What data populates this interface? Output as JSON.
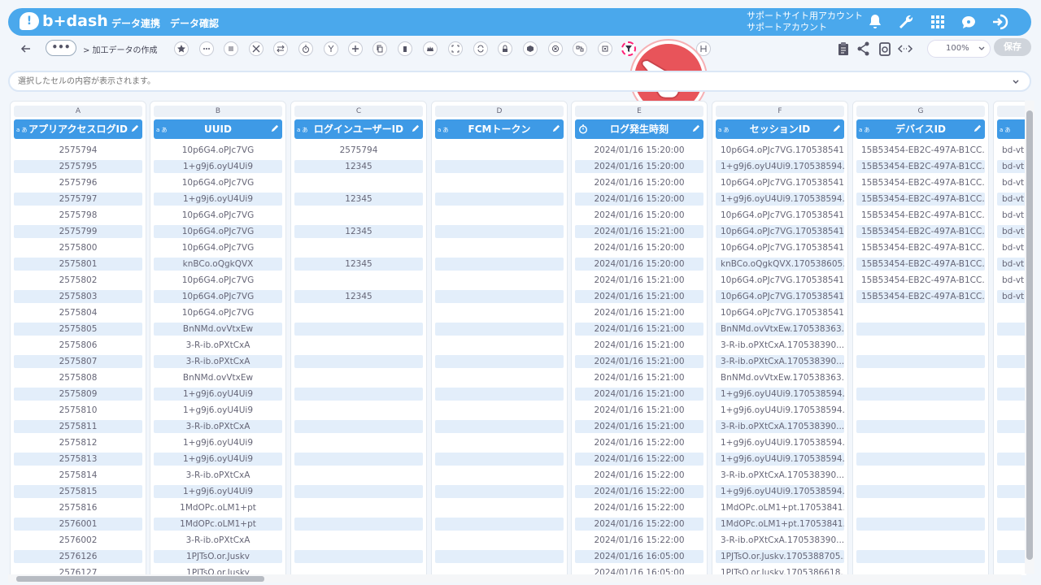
{
  "app": {
    "logo_text": "b+dash"
  },
  "nav": {
    "items": [
      "データ連携",
      "データ確認"
    ]
  },
  "account": {
    "line1": "サポートサイト用アカウント",
    "line2": "サポートアカウント"
  },
  "toolbar": {
    "more_label": "•••",
    "breadcrumb": "> 加工データの作成",
    "zoom": "100%",
    "save_label": "保存"
  },
  "cellbar": {
    "placeholder": "選択したセルの内容が表示されます。"
  },
  "columns": [
    {
      "letter": "A",
      "name": "アプリアクセスログID",
      "type": "a あ",
      "align": "center",
      "cells": [
        "2575794",
        "2575795",
        "2575796",
        "2575797",
        "2575798",
        "2575799",
        "2575800",
        "2575801",
        "2575802",
        "2575803",
        "2575804",
        "2575805",
        "2575806",
        "2575807",
        "2575808",
        "2575809",
        "2575810",
        "2575811",
        "2575812",
        "2575813",
        "2575814",
        "2575815",
        "2575816",
        "2576001",
        "2576002",
        "2576126",
        "2576127"
      ]
    },
    {
      "letter": "B",
      "name": "UUID",
      "type": "a あ",
      "align": "center",
      "cells": [
        "10p6G4.oPJc7VG",
        "1+g9j6.oyU4Ui9",
        "10p6G4.oPJc7VG",
        "1+g9j6.oyU4Ui9",
        "10p6G4.oPJc7VG",
        "10p6G4.oPJc7VG",
        "10p6G4.oPJc7VG",
        "knBCo.oQgkQVX",
        "10p6G4.oPJc7VG",
        "10p6G4.oPJc7VG",
        "10p6G4.oPJc7VG",
        "BnNMd.ovVtxEw",
        "3-R-ib.oPXtCxA",
        "3-R-ib.oPXtCxA",
        "BnNMd.ovVtxEw",
        "1+g9j6.oyU4Ui9",
        "1+g9j6.oyU4Ui9",
        "3-R-ib.oPXtCxA",
        "1+g9j6.oyU4Ui9",
        "1+g9j6.oyU4Ui9",
        "3-R-ib.oPXtCxA",
        "1+g9j6.oyU4Ui9",
        "1MdOPc.oLM1+pt",
        "1MdOPc.oLM1+pt",
        "3-R-ib.oPXtCxA",
        "1PJTsO.or.Juskv",
        "1PJTsO.or.Jusky"
      ]
    },
    {
      "letter": "C",
      "name": "ログインユーザーID",
      "type": "a あ",
      "align": "center",
      "cells": [
        "2575794",
        "12345",
        "",
        "12345",
        "",
        "12345",
        "",
        "12345",
        "",
        "12345",
        "",
        "",
        "",
        "",
        "",
        "",
        "",
        "",
        "",
        "",
        "",
        "",
        "",
        "",
        "",
        "",
        ""
      ]
    },
    {
      "letter": "D",
      "name": "FCMトークン",
      "type": "a あ",
      "align": "center",
      "cells": [
        "",
        "",
        "",
        "",
        "",
        "",
        "",
        "",
        "",
        "",
        "",
        "",
        "",
        "",
        "",
        "",
        "",
        "",
        "",
        "",
        "",
        "",
        "",
        "",
        "",
        "",
        ""
      ]
    },
    {
      "letter": "E",
      "name": "ログ発生時刻",
      "type": "clock",
      "align": "center",
      "cells": [
        "2024/01/16 15:20:00",
        "2024/01/16 15:20:00",
        "2024/01/16 15:20:00",
        "2024/01/16 15:20:00",
        "2024/01/16 15:20:00",
        "2024/01/16 15:21:00",
        "2024/01/16 15:20:00",
        "2024/01/16 15:20:00",
        "2024/01/16 15:21:00",
        "2024/01/16 15:21:00",
        "2024/01/16 15:21:00",
        "2024/01/16 15:21:00",
        "2024/01/16 15:21:00",
        "2024/01/16 15:21:00",
        "2024/01/16 15:21:00",
        "2024/01/16 15:21:00",
        "2024/01/16 15:21:00",
        "2024/01/16 15:21:00",
        "2024/01/16 15:22:00",
        "2024/01/16 15:22:00",
        "2024/01/16 15:22:00",
        "2024/01/16 15:22:00",
        "2024/01/16 15:22:00",
        "2024/01/16 15:22:00",
        "2024/01/16 15:22:00",
        "2024/01/16 16:05:00",
        "2024/01/16 16:05:00"
      ]
    },
    {
      "letter": "F",
      "name": "セッションID",
      "type": "a あ",
      "align": "left",
      "cells": [
        "10p6G4.oPJc7VG.170538541...",
        "1+g9j6.oyU4Ui9.170538594...",
        "10p6G4.oPJc7VG.170538541...",
        "1+g9j6.oyU4Ui9.170538594...",
        "10p6G4.oPJc7VG.170538541...",
        "10p6G4.oPJc7VG.170538541...",
        "10p6G4.oPJc7VG.170538541...",
        "knBCo.oQgkQVX.170538605...",
        "10p6G4.oPJc7VG.170538541...",
        "10p6G4.oPJc7VG.170538541...",
        "10p6G4.oPJc7VG.170538541...",
        "BnNMd.ovVtxEw.170538363...",
        "3-R-ib.oPXtCxA.170538390...",
        "3-R-ib.oPXtCxA.170538390...",
        "BnNMd.ovVtxEw.170538363...",
        "1+g9j6.oyU4Ui9.170538594...",
        "1+g9j6.oyU4Ui9.170538594...",
        "3-R-ib.oPXtCxA.170538390...",
        "1+g9j6.oyU4Ui9.170538594...",
        "1+g9j6.oyU4Ui9.170538594...",
        "3-R-ib.oPXtCxA.170538390...",
        "1+g9j6.oyU4Ui9.170538594...",
        "1MdOPc.oLM1+pt.17053841...",
        "1MdOPc.oLM1+pt.17053841...",
        "3-R-ib.oPXtCxA.170538390...",
        "1PJTsO.or.Juskv.1705388705...",
        "1PJTsO.or.Juskv.1705386618..."
      ]
    },
    {
      "letter": "G",
      "name": "デバイスID",
      "type": "a あ",
      "align": "left",
      "cells": [
        "15B53454-EB2C-497A-B1CC...",
        "15B53454-EB2C-497A-B1CC...",
        "15B53454-EB2C-497A-B1CC...",
        "15B53454-EB2C-497A-B1CC...",
        "15B53454-EB2C-497A-B1CC...",
        "15B53454-EB2C-497A-B1CC...",
        "15B53454-EB2C-497A-B1CC...",
        "15B53454-EB2C-497A-B1CC...",
        "15B53454-EB2C-497A-B1CC...",
        "15B53454-EB2C-497A-B1CC...",
        "",
        "",
        "",
        "",
        "",
        "",
        "",
        "",
        "",
        "",
        "",
        "",
        "",
        "",
        "",
        "",
        ""
      ]
    },
    {
      "letter": "",
      "name": "",
      "type": "a あ",
      "align": "left",
      "cells": [
        "bd-vt",
        "bd-vt",
        "bd-vt",
        "bd-vt",
        "bd-vt",
        "bd-vt",
        "bd-vt",
        "bd-vt",
        "bd-vt",
        "bd-vt",
        "",
        "",
        "",
        "",
        "",
        "",
        "",
        "",
        "",
        "",
        "",
        "",
        "",
        "",
        "",
        "",
        ""
      ]
    }
  ],
  "colors": {
    "brand": "#4aa8ec",
    "header": "#3e9ae6",
    "pointer": "#e8545a"
  }
}
